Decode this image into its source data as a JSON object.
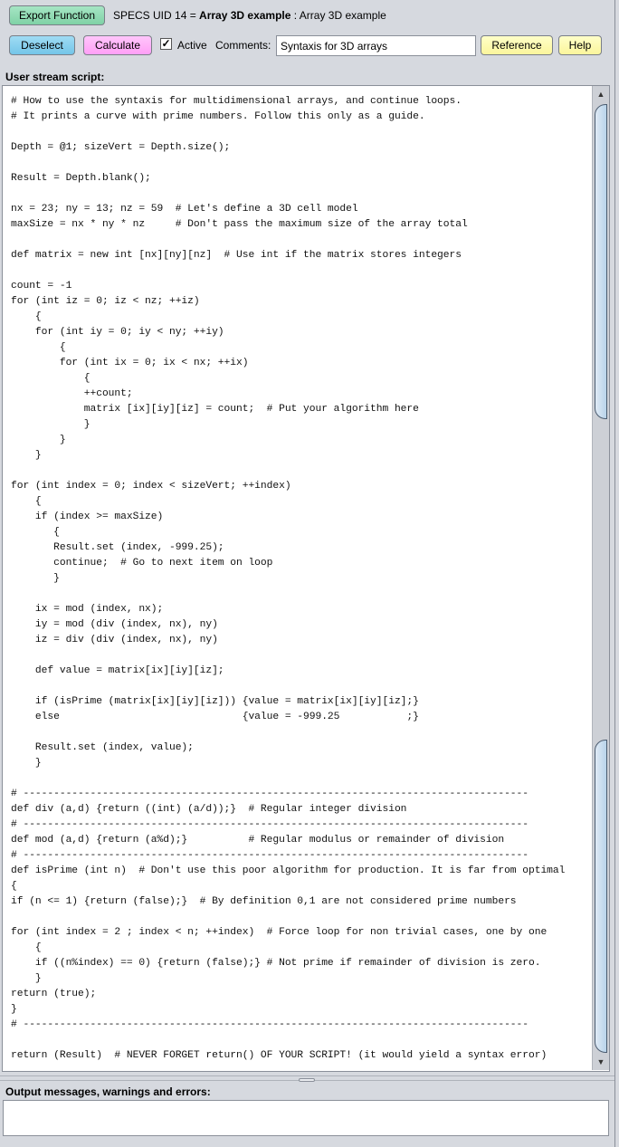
{
  "toolbar": {
    "export_function_label": "Export Function",
    "title_prefix": "SPECS UID 14 = ",
    "title_bold": "Array 3D example",
    "title_suffix": " : Array 3D example",
    "deselect_label": "Deselect",
    "calculate_label": "Calculate",
    "active_checked_glyph": "✓",
    "active_label": "Active",
    "comments_label": "Comments:",
    "comments_value": "Syntaxis for 3D arrays",
    "reference_label": "Reference",
    "help_label": "Help"
  },
  "script": {
    "label": "User stream script:",
    "lines": [
      "# How to use the syntaxis for multidimensional arrays, and continue loops.",
      "# It prints a curve with prime numbers. Follow this only as a guide.",
      "",
      "Depth = @1; sizeVert = Depth.size();",
      "",
      "Result = Depth.blank();",
      "",
      "nx = 23; ny = 13; nz = 59  # Let's define a 3D cell model",
      "maxSize = nx * ny * nz     # Don't pass the maximum size of the array total",
      "",
      "def matrix = new int [nx][ny][nz]  # Use int if the matrix stores integers",
      "",
      "count = -1",
      "for (int iz = 0; iz < nz; ++iz)",
      "    {",
      "    for (int iy = 0; iy < ny; ++iy)",
      "        {",
      "        for (int ix = 0; ix < nx; ++ix)",
      "            {",
      "            ++count;",
      "            matrix [ix][iy][iz] = count;  # Put your algorithm here",
      "            }",
      "        }",
      "    }",
      "",
      "for (int index = 0; index < sizeVert; ++index)",
      "    {",
      "    if (index >= maxSize)",
      "       {",
      "       Result.set (index, -999.25);",
      "       continue;  # Go to next item on loop",
      "       }",
      "",
      "    ix = mod (index, nx);",
      "    iy = mod (div (index, nx), ny)",
      "    iz = div (div (index, nx), ny)",
      "",
      "    def value = matrix[ix][iy][iz];",
      "",
      "    if (isPrime (matrix[ix][iy][iz])) {value = matrix[ix][iy][iz];}",
      "    else                              {value = -999.25           ;}",
      "",
      "    Result.set (index, value);",
      "    }",
      "",
      "# -----------------------------------------------------------------------------------",
      "def div (a,d) {return ((int) (a/d));}  # Regular integer division",
      "# -----------------------------------------------------------------------------------",
      "def mod (a,d) {return (a%d);}          # Regular modulus or remainder of division",
      "# -----------------------------------------------------------------------------------",
      "def isPrime (int n)  # Don't use this poor algorithm for production. It is far from optimal",
      "{",
      "if (n <= 1) {return (false);}  # By definition 0,1 are not considered prime numbers",
      "",
      "for (int index = 2 ; index < n; ++index)  # Force loop for non trivial cases, one by one",
      "    {",
      "    if ((n%index) == 0) {return (false);} # Not prime if remainder of division is zero.",
      "    }",
      "return (true);",
      "}",
      "# -----------------------------------------------------------------------------------",
      "",
      "return (Result)  # NEVER FORGET return() OF YOUR SCRIPT! (it would yield a syntax error)"
    ],
    "scroll_up_glyph": "▲",
    "scroll_down_glyph": "▼"
  },
  "output": {
    "label": "Output messages, warnings and errors:",
    "value": ""
  }
}
